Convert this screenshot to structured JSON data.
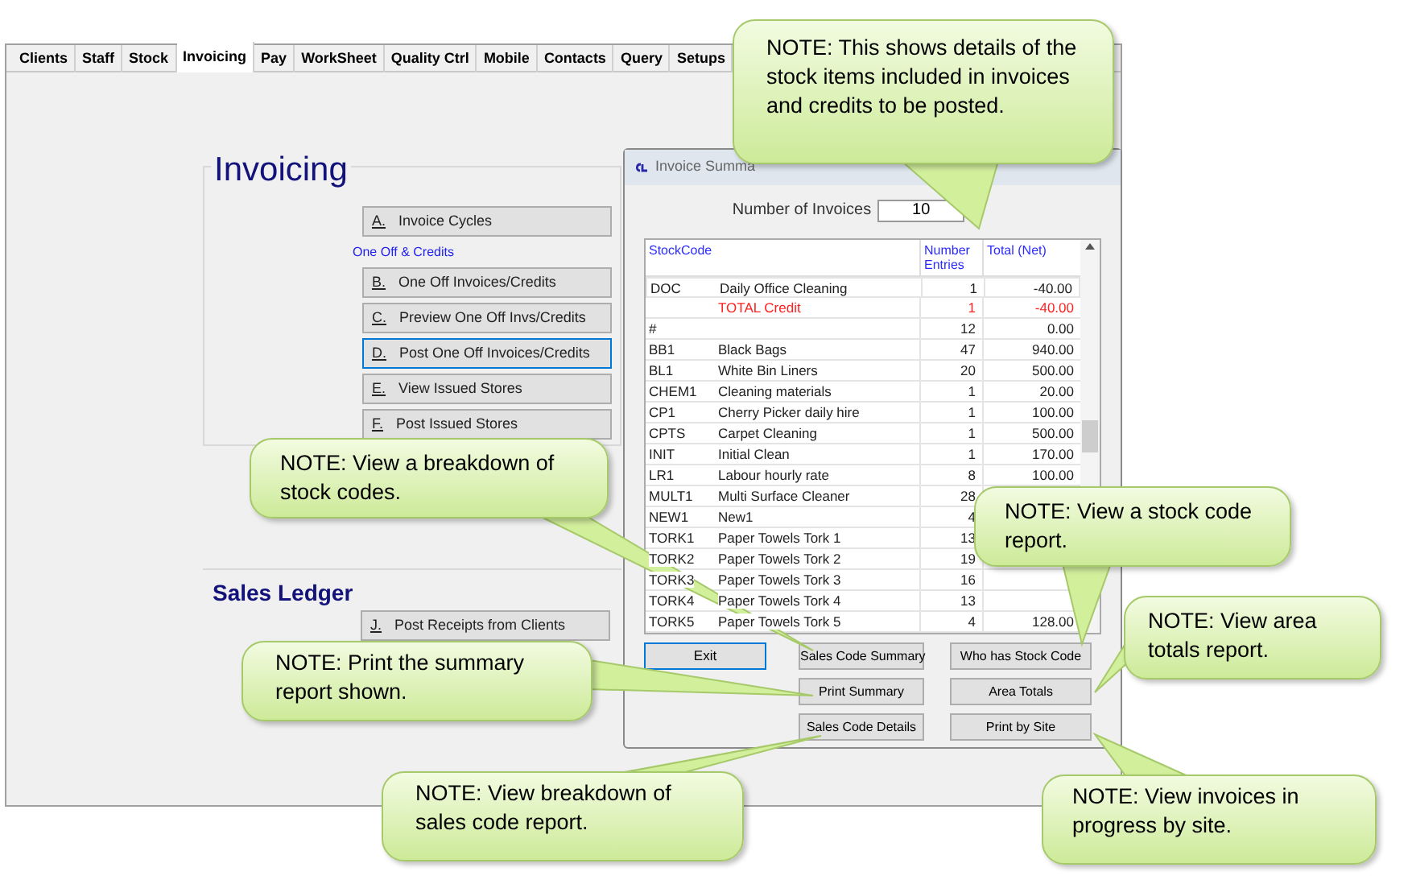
{
  "tabs": [
    {
      "label": "Clients",
      "selected": false
    },
    {
      "label": "Staff",
      "selected": false
    },
    {
      "label": "Stock",
      "selected": false
    },
    {
      "label": "Invoicing",
      "selected": true
    },
    {
      "label": "Pay",
      "selected": false
    },
    {
      "label": "WorkSheet",
      "selected": false
    },
    {
      "label": "Quality Ctrl",
      "selected": false
    },
    {
      "label": "Mobile",
      "selected": false
    },
    {
      "label": "Contacts",
      "selected": false
    },
    {
      "label": "Query",
      "selected": false
    },
    {
      "label": "Setups",
      "selected": false
    }
  ],
  "invoicing": {
    "title": "Invoicing",
    "menu": [
      {
        "kind": "button",
        "key": "A.",
        "label": "Invoice Cycles",
        "focused": false
      },
      {
        "kind": "heading",
        "label": "One Off & Credits"
      },
      {
        "kind": "button",
        "key": "B.",
        "label": "One Off Invoices/Credits",
        "focused": false
      },
      {
        "kind": "button",
        "key": "C.",
        "label": "Preview One Off Invs/Credits",
        "focused": false
      },
      {
        "kind": "button",
        "key": "D.",
        "label": "Post One Off Invoices/Credits",
        "focused": true
      },
      {
        "kind": "button",
        "key": "E.",
        "label": "View Issued Stores",
        "focused": false
      },
      {
        "kind": "button",
        "key": "F.",
        "label": "Post Issued Stores",
        "focused": false
      }
    ]
  },
  "sales_ledger": {
    "title": "Sales Ledger",
    "buttons": [
      {
        "key": "J.",
        "label": "Post Receipts from Clients"
      }
    ]
  },
  "dialog": {
    "title": "Invoice Summa",
    "count_label": "Number of Invoices",
    "count_value": "10",
    "columns": [
      "StockCode",
      "Number Entries",
      "Total (Net)"
    ],
    "rows": [
      {
        "kind": "selected",
        "code": "DOC",
        "description": "Daily Office Cleaning",
        "entries": "1",
        "total": "-40.00"
      },
      {
        "kind": "total",
        "code": "",
        "description": "TOTAL Credit",
        "entries": "1",
        "total": "-40.00"
      },
      {
        "kind": "normal",
        "code": "#",
        "description": "",
        "entries": "12",
        "total": "0.00"
      },
      {
        "kind": "normal",
        "code": "BB1",
        "description": "Black Bags",
        "entries": "47",
        "total": "940.00"
      },
      {
        "kind": "normal",
        "code": "BL1",
        "description": "White Bin Liners",
        "entries": "20",
        "total": "500.00"
      },
      {
        "kind": "normal",
        "code": "CHEM1",
        "description": "Cleaning materials",
        "entries": "1",
        "total": "20.00"
      },
      {
        "kind": "normal",
        "code": "CP1",
        "description": "Cherry Picker daily hire",
        "entries": "1",
        "total": "100.00"
      },
      {
        "kind": "normal",
        "code": "CPTS",
        "description": "Carpet Cleaning",
        "entries": "1",
        "total": "500.00"
      },
      {
        "kind": "normal",
        "code": "INIT",
        "description": "Initial Clean",
        "entries": "1",
        "total": "170.00"
      },
      {
        "kind": "normal",
        "code": "LR1",
        "description": "Labour hourly rate",
        "entries": "8",
        "total": "100.00"
      },
      {
        "kind": "normal",
        "code": "MULT1",
        "description": "Multi Surface Cleaner",
        "entries": "28",
        "total": ""
      },
      {
        "kind": "normal",
        "code": "NEW1",
        "description": "New1",
        "entries": "4",
        "total": ""
      },
      {
        "kind": "normal",
        "code": "TORK1",
        "description": "Paper Towels Tork 1",
        "entries": "13",
        "total": ""
      },
      {
        "kind": "normal",
        "code": "TORK2",
        "description": "Paper Towels Tork 2",
        "entries": "19",
        "total": ""
      },
      {
        "kind": "normal",
        "code": "TORK3",
        "description": "Paper Towels Tork 3",
        "entries": "16",
        "total": ""
      },
      {
        "kind": "normal",
        "code": "TORK4",
        "description": "Paper Towels Tork 4",
        "entries": "13",
        "total": ""
      },
      {
        "kind": "normal",
        "code": "TORK5",
        "description": "Paper Towels Tork 5",
        "entries": "4",
        "total": "128.00"
      }
    ],
    "exit_button": {
      "label": "Exit",
      "focused": true
    },
    "report_buttons": [
      "Sales Code Summary",
      "Who has Stock Code",
      "Print Summary",
      "Area Totals",
      "Sales Code Details",
      "Print by Site"
    ]
  },
  "notes": [
    "NOTE: This shows details of the stock items included in invoices and credits to be posted.",
    "NOTE: View a breakdown of stock codes.",
    "NOTE: View a stock code report.",
    "NOTE: View area totals report.",
    "NOTE: Print the summary report shown.",
    "NOTE: View breakdown of sales code report.",
    "NOTE: View invoices in progress by site."
  ]
}
